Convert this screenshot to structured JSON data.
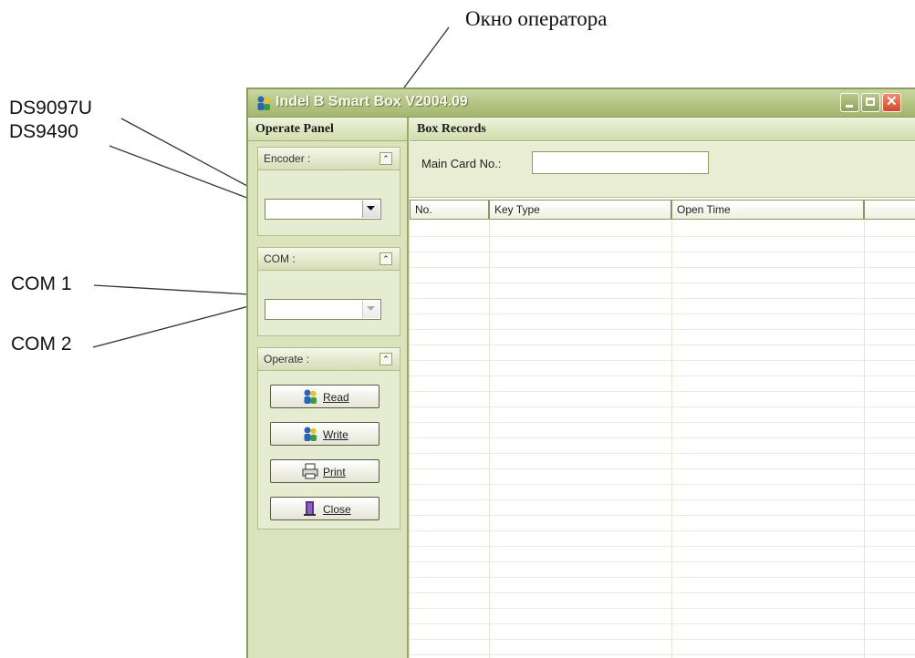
{
  "annotations": {
    "operator_window": "Окно оператора",
    "encoder_option_1": "DS9097U",
    "encoder_option_2": "DS9490",
    "com_option_1": "COM 1",
    "com_option_2": "COM 2"
  },
  "window": {
    "title": "Indel B Smart Box V2004.09",
    "controls": {
      "minimize": "minimize",
      "maximize": "maximize",
      "close": "close"
    }
  },
  "operate_panel": {
    "title": "Operate Panel",
    "encoder": {
      "label": "Encoder :",
      "value": ""
    },
    "com": {
      "label": "COM :",
      "value": ""
    },
    "operate": {
      "label": "Operate :",
      "buttons": [
        {
          "label": "Read",
          "icon": "users-icon"
        },
        {
          "label": "Write",
          "icon": "users-icon"
        },
        {
          "label": "Print",
          "icon": "printer-icon"
        },
        {
          "label": "Close",
          "icon": "door-icon"
        }
      ]
    }
  },
  "box_records": {
    "title": "Box Records",
    "main_card_label": "Main Card No.:",
    "main_card_value": "",
    "columns": [
      "No.",
      "Key Type",
      "Open Time",
      ""
    ]
  },
  "colors": {
    "titlebar": "#b3c382",
    "panel": "#dbe3bc",
    "close_button": "#d3472a"
  }
}
